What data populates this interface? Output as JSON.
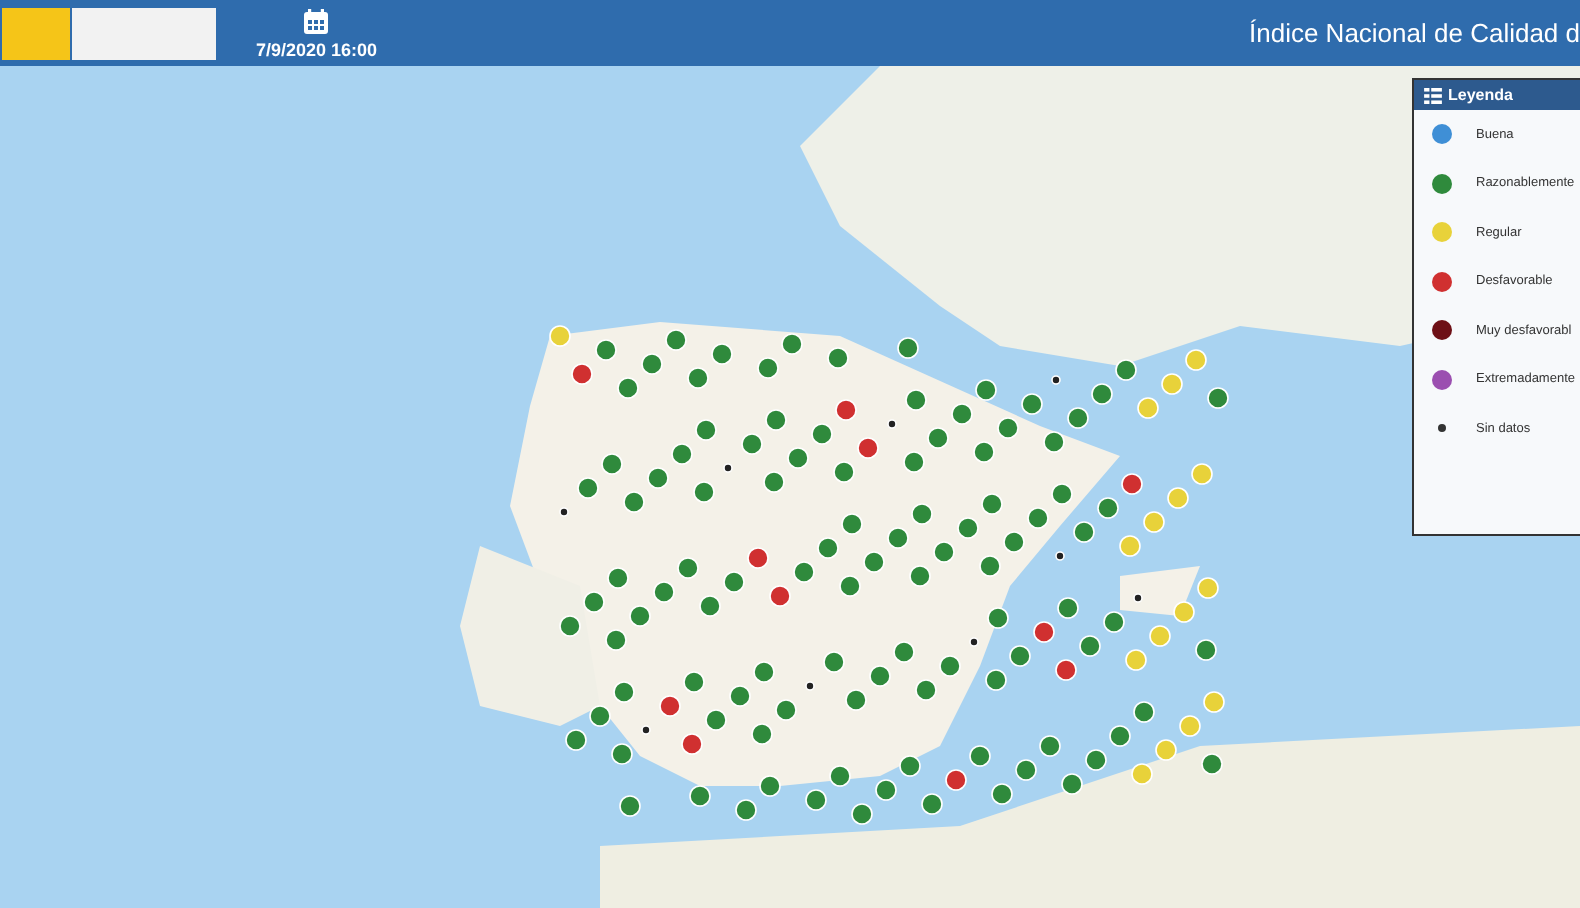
{
  "header": {
    "date": "7/9/2020 16:00",
    "title": "Índice Nacional de Calidad d"
  },
  "legend": {
    "title": "Leyenda",
    "items": [
      {
        "label": "Buena",
        "color": "#3f8fd6",
        "kind": "ball"
      },
      {
        "label": "Razonablemente",
        "color": "#2f8a3c",
        "kind": "ball"
      },
      {
        "label": "Regular",
        "color": "#e8d23a",
        "kind": "ball"
      },
      {
        "label": "Desfavorable",
        "color": "#d03030",
        "kind": "ball"
      },
      {
        "label": "Muy desfavorabl",
        "color": "#6e1016",
        "kind": "ball"
      },
      {
        "label": "Extremadamente",
        "color": "#9b4fb0",
        "kind": "ball"
      },
      {
        "label": "Sin datos",
        "color": "#333333",
        "kind": "dot"
      }
    ]
  }
}
